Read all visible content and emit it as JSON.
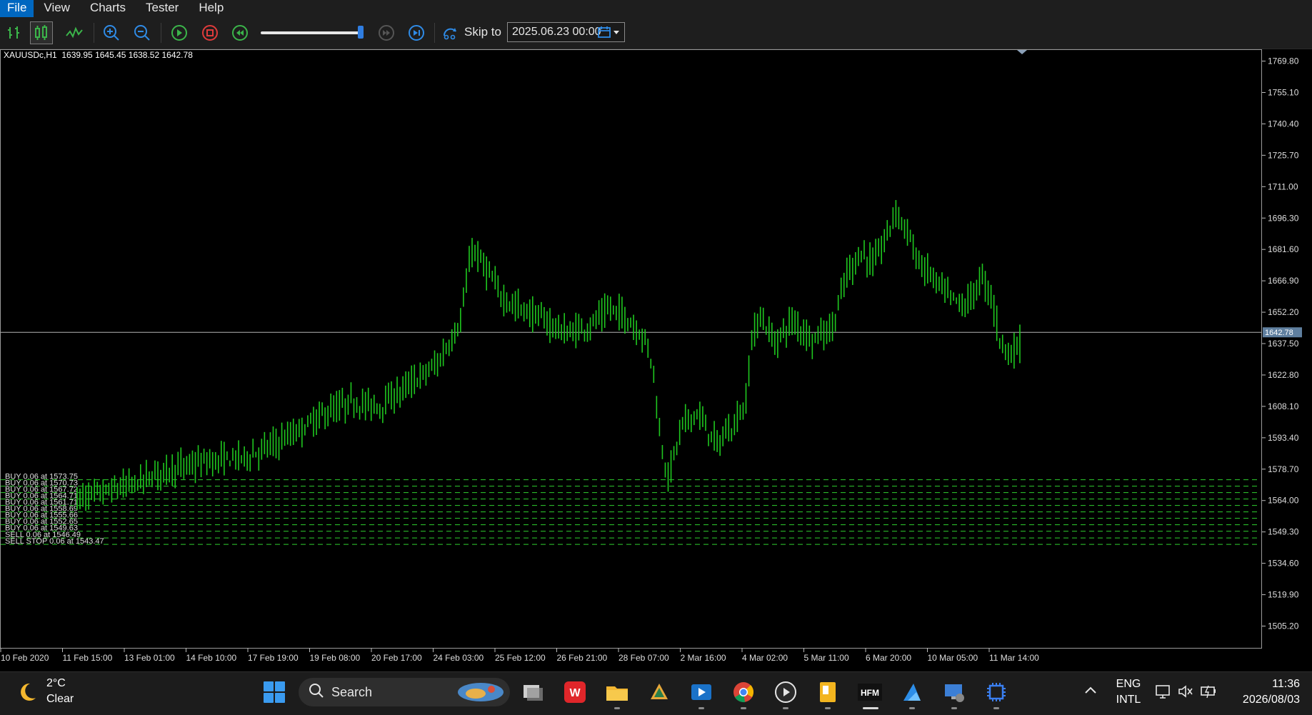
{
  "menu": [
    "File",
    "View",
    "Charts",
    "Tester",
    "Help"
  ],
  "toolbar": {
    "skip_label": "Skip to",
    "skip_date": "2025.06.23 00:00",
    "speed_fraction": 0.95
  },
  "chart": {
    "symbol_info": "XAUUSDc,H1  1639.95 1645.45 1638.52 1642.78",
    "current_price": 1642.78,
    "current_price_label": "1642.78",
    "y_range": [
      1495.0,
      1775.0
    ],
    "y_ticks": [
      "1769.80",
      "1755.10",
      "1740.40",
      "1725.70",
      "1711.00",
      "1696.30",
      "1681.60",
      "1666.90",
      "1652.20",
      "1637.50",
      "1622.80",
      "1608.10",
      "1593.40",
      "1578.70",
      "1564.00",
      "1549.30",
      "1534.60",
      "1519.90",
      "1505.20"
    ],
    "x_ticks": [
      "10 Feb 2020",
      "11 Feb 15:00",
      "13 Feb 01:00",
      "14 Feb 10:00",
      "17 Feb 19:00",
      "19 Feb 08:00",
      "20 Feb 17:00",
      "24 Feb 03:00",
      "25 Feb 12:00",
      "26 Feb 21:00",
      "28 Feb 07:00",
      "2 Mar 16:00",
      "4 Mar 02:00",
      "5 Mar 11:00",
      "6 Mar 20:00",
      "10 Mar 05:00",
      "11 Mar 14:00"
    ],
    "orders": [
      {
        "label": "BUY 0.06 at 1573.75",
        "price": 1573.75
      },
      {
        "label": "BUY 0.06 at 1570.73",
        "price": 1570.73
      },
      {
        "label": "BUY 0.06 at 1567.72",
        "price": 1567.72
      },
      {
        "label": "BUY 0.06 at 1564.71",
        "price": 1564.71
      },
      {
        "label": "BUY 0.06 at 1561.71",
        "price": 1561.71
      },
      {
        "label": "BUY 0.06 at 1558.69",
        "price": 1558.69
      },
      {
        "label": "BUY 0.06 at 1555.66",
        "price": 1555.66
      },
      {
        "label": "BUY 0.06 at 1552.65",
        "price": 1552.65
      },
      {
        "label": "BUY 0.06 at 1549.63",
        "price": 1549.63
      },
      {
        "label": "SELL 0.06 at 1546.49",
        "price": 1546.49
      },
      {
        "label": "SELL STOP 0.06 at 1543.47",
        "price": 1543.47
      }
    ],
    "series_keypoints": [
      [
        0,
        1565
      ],
      [
        10,
        1568
      ],
      [
        20,
        1572
      ],
      [
        30,
        1578
      ],
      [
        45,
        1582
      ],
      [
        60,
        1585
      ],
      [
        75,
        1595
      ],
      [
        85,
        1604
      ],
      [
        95,
        1610
      ],
      [
        105,
        1608
      ],
      [
        115,
        1618
      ],
      [
        125,
        1628
      ],
      [
        130,
        1640
      ],
      [
        133,
        1648
      ],
      [
        137,
        1682
      ],
      [
        142,
        1672
      ],
      [
        147,
        1660
      ],
      [
        152,
        1655
      ],
      [
        160,
        1650
      ],
      [
        170,
        1642
      ],
      [
        178,
        1646
      ],
      [
        185,
        1654
      ],
      [
        190,
        1650
      ],
      [
        197,
        1640
      ],
      [
        200,
        1625
      ],
      [
        202,
        1595
      ],
      [
        205,
        1575
      ],
      [
        210,
        1600
      ],
      [
        215,
        1605
      ],
      [
        222,
        1590
      ],
      [
        228,
        1600
      ],
      [
        232,
        1610
      ],
      [
        234,
        1640
      ],
      [
        237,
        1650
      ],
      [
        242,
        1638
      ],
      [
        248,
        1648
      ],
      [
        255,
        1640
      ],
      [
        262,
        1645
      ],
      [
        267,
        1670
      ],
      [
        272,
        1680
      ],
      [
        276,
        1675
      ],
      [
        280,
        1685
      ],
      [
        284,
        1700
      ],
      [
        288,
        1690
      ],
      [
        292,
        1675
      ],
      [
        296,
        1670
      ],
      [
        302,
        1660
      ],
      [
        308,
        1655
      ],
      [
        314,
        1668
      ],
      [
        317,
        1660
      ],
      [
        320,
        1640
      ],
      [
        324,
        1632
      ],
      [
        328,
        1640
      ]
    ]
  },
  "taskbar": {
    "weather_temp": "2°C",
    "weather_cond": "Clear",
    "search_placeholder": "Search",
    "lang_1": "ENG",
    "lang_2": "INTL",
    "time": "11:36",
    "date": "2026/08/03"
  }
}
